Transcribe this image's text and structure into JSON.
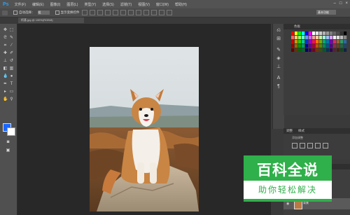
{
  "app": {
    "logo": "Ps"
  },
  "menu": [
    "文件(F)",
    "编辑(E)",
    "图像(I)",
    "图层(L)",
    "类型(Y)",
    "选择(S)",
    "滤镜(T)",
    "视图(V)",
    "窗口(W)",
    "帮助(H)"
  ],
  "window_controls": [
    "–",
    "□",
    "×"
  ],
  "options_bar": {
    "auto_select_label": "自动选择：",
    "auto_select_value": "组",
    "show_transform_label": "显示变换控件",
    "workspace": "基本功能"
  },
  "document_tab": {
    "label": "柯基.jpg @ 100%(RGB/8)"
  },
  "panels": {
    "swatches_tab": "色板",
    "adjust_tabs": [
      "调整",
      "样式"
    ],
    "adjust_hint": "添加调整",
    "layers_tab": "图层",
    "layer_name": "背景"
  },
  "colors": {
    "foreground": "#1a66ff",
    "background": "#ffffff",
    "accent": "#2fb04a"
  },
  "watermark": {
    "title": "百科全说",
    "subtitle": "助你轻松解决"
  }
}
